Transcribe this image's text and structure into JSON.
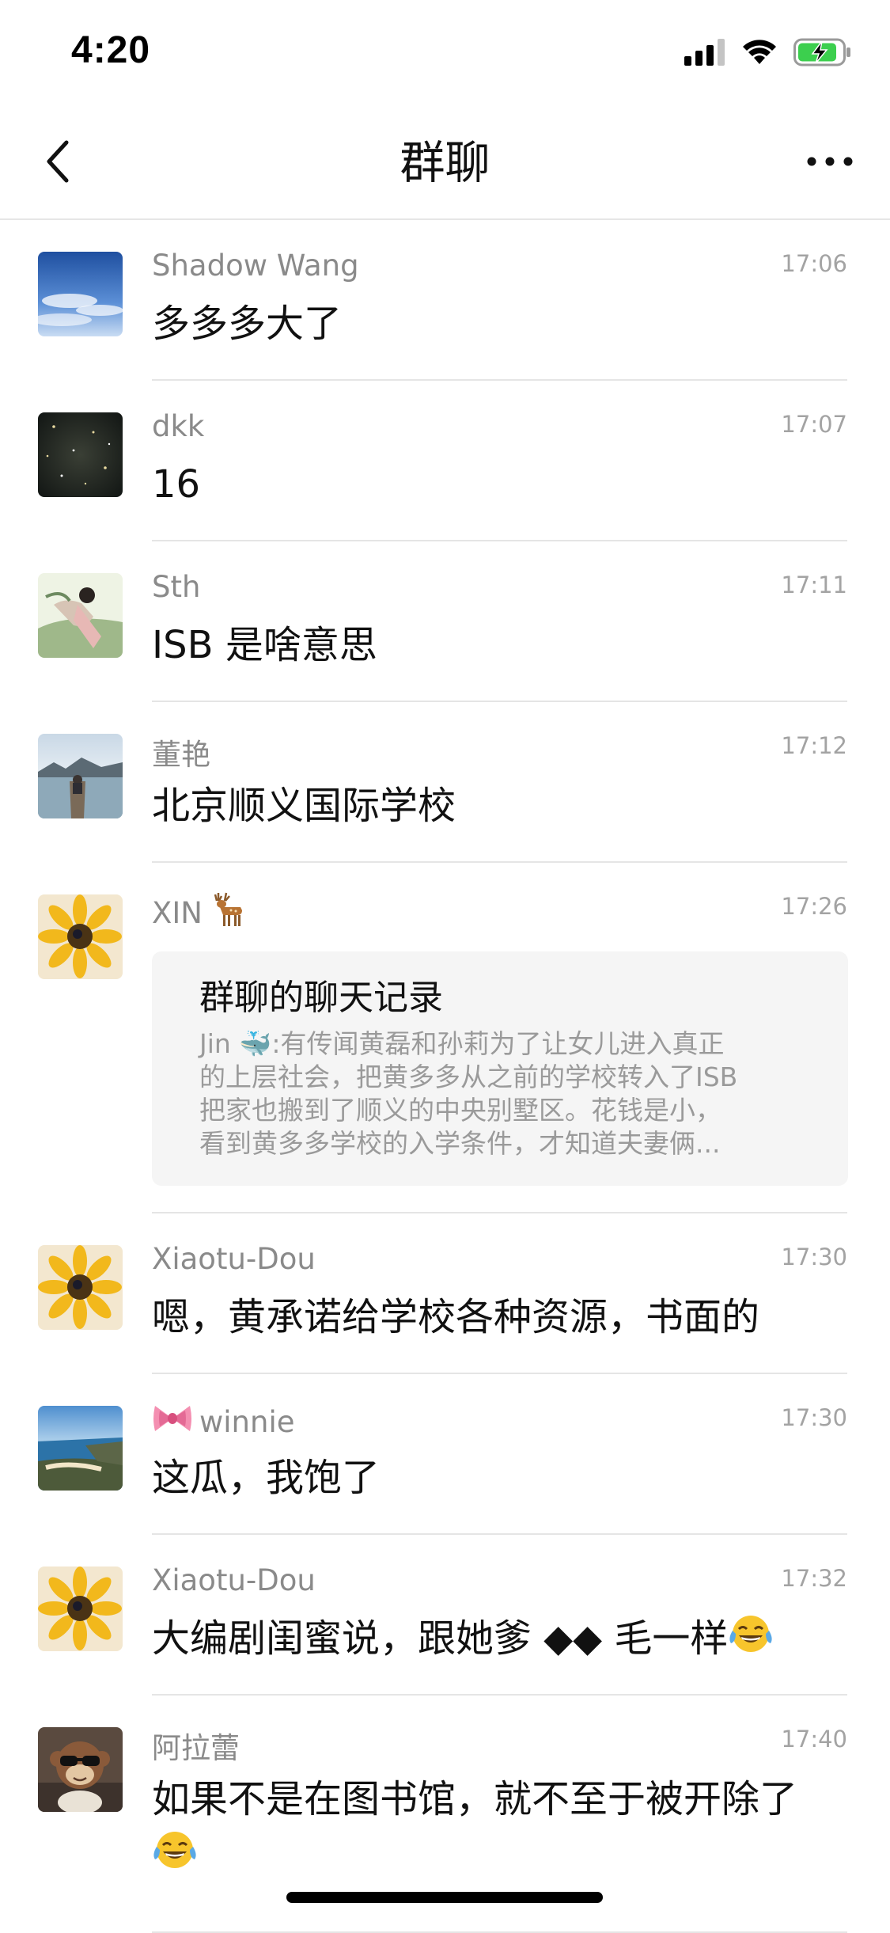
{
  "status_bar": {
    "time": "4:20",
    "signal": "signal-icon",
    "wifi": "wifi-icon",
    "battery": "battery-charging-icon"
  },
  "nav": {
    "back_icon": "chevron-left-icon",
    "title": "群聊",
    "more_icon": "ellipsis-icon"
  },
  "messages": [
    {
      "sender": "Shadow Wang",
      "time": "17:06",
      "text": "多多多大了",
      "avatar": "sky-avatar"
    },
    {
      "sender": "dkk",
      "time": "17:07",
      "text": "16",
      "avatar": "starfield-avatar"
    },
    {
      "sender": "Sth",
      "time": "17:11",
      "text": "ISB 是啥意思",
      "avatar": "illustration-avatar"
    },
    {
      "sender": "董艳",
      "time": "17:12",
      "text": "北京顺义国际学校",
      "avatar": "lake-avatar"
    },
    {
      "sender": "XIN",
      "sender_emoji": "deer-emoji",
      "time": "17:26",
      "avatar": "sunflower-avatar",
      "card": {
        "title": "群聊的聊天记录",
        "body": [
          "Jin 🐳:有传闻黄磊和孙莉为了让女儿进入真正",
          "的上层社会，把黄多多从之前的学校转入了ISB",
          "把家也搬到了顺义的中央别墅区。花钱是小，",
          "看到黄多多学校的入学条件，才知道夫妻俩..."
        ]
      }
    },
    {
      "sender": "Xiaotu-Dou",
      "time": "17:30",
      "text": "嗯，黄承诺给学校各种资源，书面的",
      "avatar": "sunflower-avatar"
    },
    {
      "sender": "winnie",
      "sender_emoji": "ribbon-emoji",
      "time": "17:30",
      "text": "这瓜，我饱了",
      "avatar": "coast-avatar"
    },
    {
      "sender": "Xiaotu-Dou",
      "time": "17:32",
      "text": "大编剧闺蜜说，跟她爹 ◆◆ 毛一样",
      "text_emoji": "tears-of-joy-emoji",
      "avatar": "sunflower-avatar"
    },
    {
      "sender": "阿拉蕾",
      "time": "17:40",
      "text_line1": "如果不是在图书馆，就不至于被开除了",
      "text_emoji": "tears-of-joy-emoji",
      "avatar": "monkey-avatar"
    }
  ]
}
